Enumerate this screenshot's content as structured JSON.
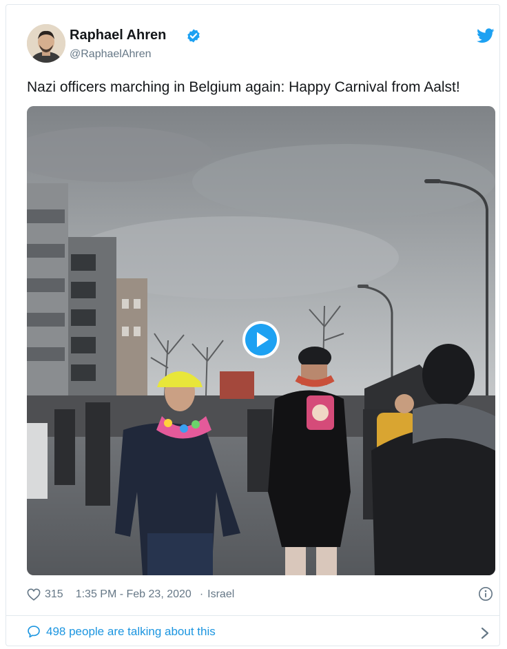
{
  "tweet": {
    "author_name": "Raphael Ahren",
    "handle": "@RaphaelAhren",
    "text": "Nazi officers marching in Belgium again: Happy Carnival from Aalst!",
    "likes": "315",
    "time": "1:35 PM - Feb 23, 2020",
    "location": "Israel",
    "separator": "·",
    "talking_link": "498 people are talking about this"
  },
  "icons": {
    "verified": "verified-badge-icon",
    "logo": "twitter-bird-icon",
    "like": "heart-icon",
    "info": "info-icon",
    "reply": "speech-bubble-icon",
    "more": "chevron-right-icon",
    "play": "play-icon"
  },
  "colors": {
    "brand": "#1da1f2",
    "link": "#1b95e0",
    "muted": "#657786"
  }
}
